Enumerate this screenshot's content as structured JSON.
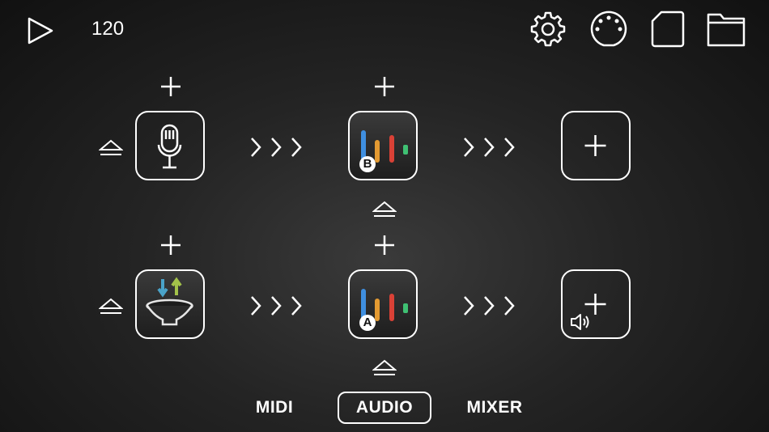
{
  "toolbar": {
    "tempo": "120",
    "icons": [
      "play-icon",
      "gear-icon",
      "midi-port-icon",
      "sd-card-icon",
      "folder-icon"
    ]
  },
  "chains": [
    {
      "input": "microphone-icon",
      "effect_badge": "B",
      "output": "add-icon"
    },
    {
      "input": "speaker-io-icon",
      "effect_badge": "A",
      "output": "add-output-speaker-icon"
    }
  ],
  "tabs": [
    {
      "label": "MIDI",
      "active": false
    },
    {
      "label": "AUDIO",
      "active": true
    },
    {
      "label": "MIXER",
      "active": false
    }
  ],
  "colors": {
    "bar_blue": "#3f8fe0",
    "bar_orange": "#e39a32",
    "bar_red": "#d94136",
    "bar_green": "#3fc073",
    "arrow_down": "#4aa3c9",
    "arrow_up": "#a3c24a"
  }
}
